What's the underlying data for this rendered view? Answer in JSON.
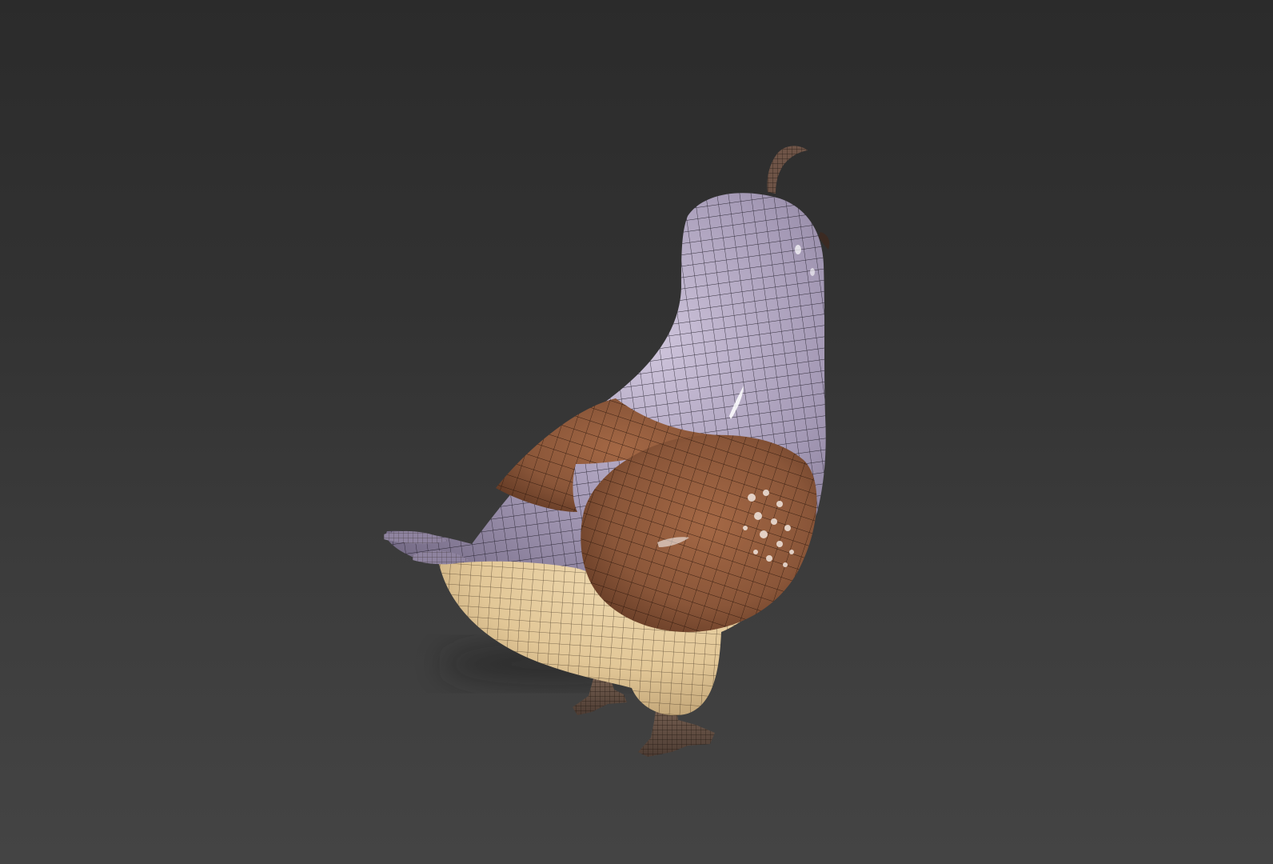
{
  "viewport": {
    "background_top": "#2b2b2b",
    "background_bottom": "#444444",
    "subject": "3d-quail-model-wireframe"
  },
  "model": {
    "colors": {
      "body_lavender": "#9d92ad",
      "body_lavender_light": "#c4b9d2",
      "wing_brown": "#8a5639",
      "wing_brown_dark": "#6e4029",
      "belly_cream": "#e7cfa2",
      "belly_shadow": "#c7ab7d",
      "feet_dark": "#5e4a3e",
      "wire": "#1c1820"
    }
  }
}
